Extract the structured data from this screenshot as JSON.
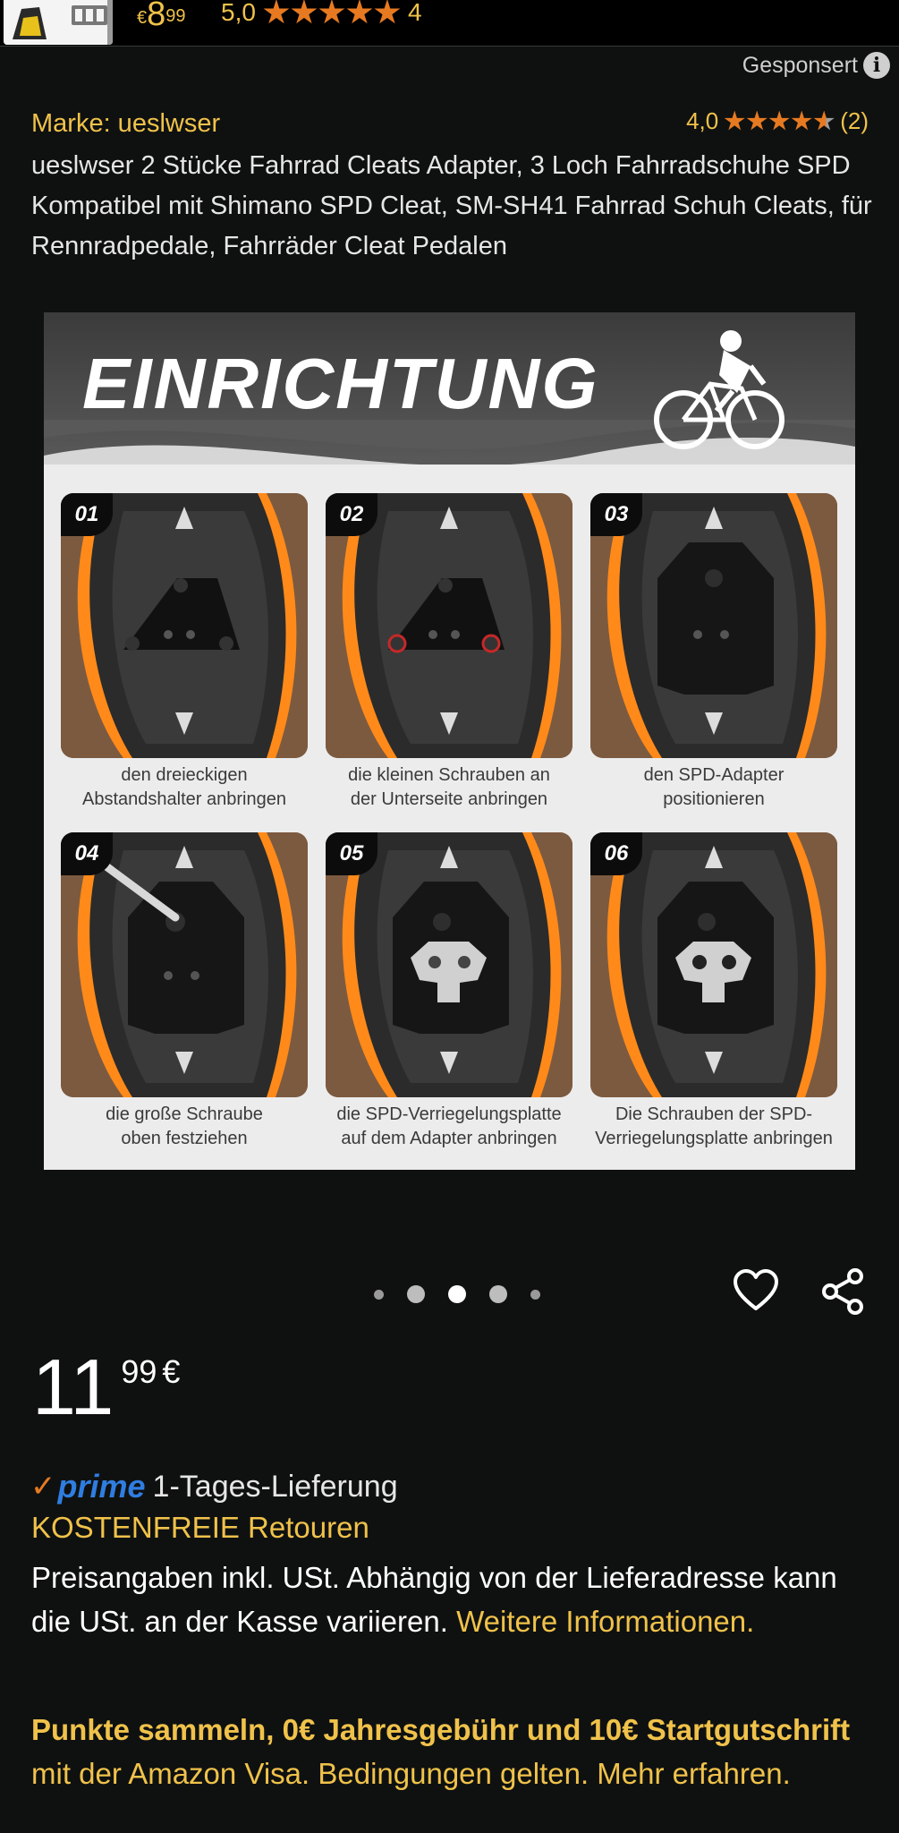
{
  "sponsored_strip": {
    "price_currency": "€",
    "price_int": "8",
    "price_frac": "99",
    "rating_value": "5,0",
    "rating_count": "4"
  },
  "sponsored_label": "Gesponsert",
  "product": {
    "brand": "Marke: ueslwser",
    "rating_value": "4,0",
    "rating_stars": 4,
    "rating_count": "(2)",
    "title": "ueslwser 2 Stücke Fahrrad Cleats Adapter, 3 Loch Fahrradschuhe SPD Kompatibel mit Shimano SPD Cleat, SM-SH41 Fahrrad Schuh Cleats, für Rennradpedale, Fahrräder Cleat Pedalen"
  },
  "image": {
    "banner_title": "EINRICHTUNG",
    "steps": [
      {
        "num": "01",
        "caption_1": "den dreieckigen",
        "caption_2": "Abstandshalter anbringen"
      },
      {
        "num": "02",
        "caption_1": "die kleinen Schrauben an",
        "caption_2": "der Unterseite anbringen"
      },
      {
        "num": "03",
        "caption_1": "den SPD-Adapter",
        "caption_2": "positionieren"
      },
      {
        "num": "04",
        "caption_1": "die große Schraube",
        "caption_2": "oben festziehen"
      },
      {
        "num": "05",
        "caption_1": "die SPD-Verriegelungsplatte",
        "caption_2": "auf dem Adapter anbringen"
      },
      {
        "num": "06",
        "caption_1": "Die Schrauben der SPD-",
        "caption_2": "Verriegelungsplatte anbringen"
      }
    ],
    "carousel_count": 5,
    "carousel_active": 3
  },
  "price": {
    "int": "11",
    "frac": "99",
    "currency": "€"
  },
  "delivery": {
    "prime_label": "prime",
    "delivery_text": "1-Tages-Lieferung",
    "returns": "KOSTENFREIE Retouren"
  },
  "vat": {
    "text": "Preisangaben inkl. USt. Abhängig von der Lieferadresse kann die USt. an der Kasse variieren. ",
    "link": "Weitere Informationen."
  },
  "visa": {
    "strong": "Punkte sammeln, 0€ Jahresgebühr und 10€ Startgutschrift",
    "rest": " mit der Amazon Visa. Bedingungen gelten. Mehr erfahren."
  },
  "colors": {
    "background": "#0f1111",
    "accent_yellow": "#f0c24a",
    "star_orange": "#e77a21",
    "prime_blue": "#2f7de1"
  },
  "icons": [
    "info-icon",
    "star-icon",
    "heart-icon",
    "share-icon",
    "prime-check-icon",
    "cyclist-icon"
  ]
}
